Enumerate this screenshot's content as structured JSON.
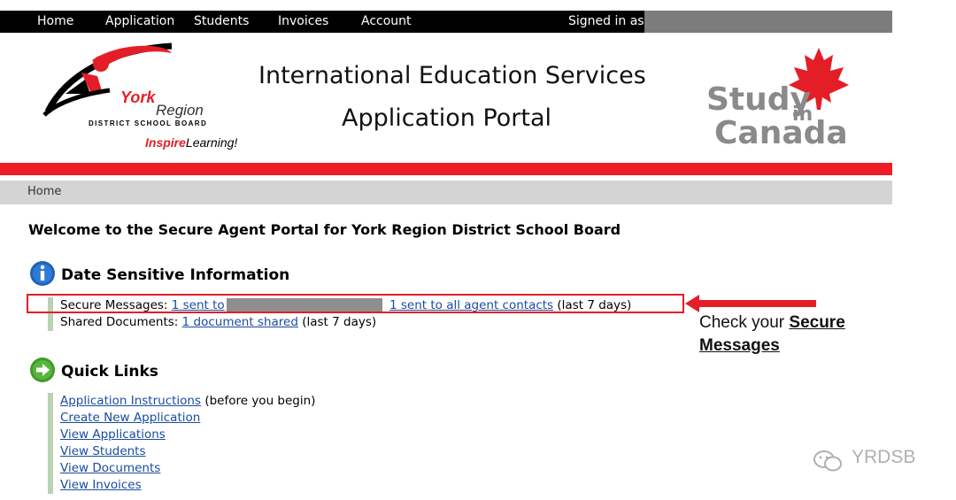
{
  "nav": {
    "items": [
      "Home",
      "Application",
      "Students",
      "Invoices",
      "Account"
    ],
    "signed_in_label": "Signed in as"
  },
  "header": {
    "title_line1": "International Education Services",
    "title_line2": "Application Portal",
    "logo_left": {
      "line1": "York",
      "line2": "Region",
      "line3": "DISTRICT SCHOOL BOARD",
      "tag_bold": "Inspire",
      "tag_rest": "Learning!"
    },
    "logo_right": {
      "word1": "Study",
      "word2": "in",
      "word3": "Canada"
    }
  },
  "breadcrumb": "Home",
  "welcome": "Welcome to the Secure Agent Portal for York Region District School Board",
  "date_sensitive": {
    "title": "Date Sensitive Information",
    "secure_label": "Secure Messages:",
    "secure_link1": "1 sent to",
    "secure_link2": "1 sent to all agent contacts",
    "secure_suffix": "(last 7 days)",
    "shared_label": "Shared Documents:",
    "shared_link": "1 document shared",
    "shared_suffix": "(last 7 days)"
  },
  "quick_links": {
    "title": "Quick Links",
    "instructions": "Application Instructions",
    "instructions_note": "(before you begin)",
    "links": [
      "Create New Application",
      "View Applications",
      "View Students",
      "View Documents",
      "View Invoices"
    ]
  },
  "annotation": {
    "prefix": "Check your",
    "bold_line1": "Secure",
    "bold_line2": "Messages"
  },
  "watermark": "YRDSB",
  "colors": {
    "accent_red": "#ee1c25",
    "link": "#1a4ca0",
    "bar_green": "#b9d2b3",
    "nav_bg": "#000000"
  }
}
